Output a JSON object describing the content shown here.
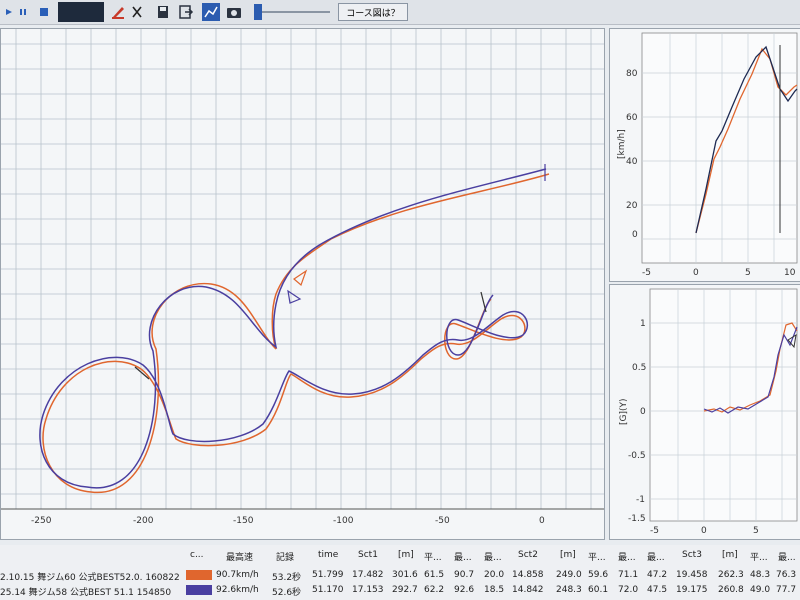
{
  "toolbar": {
    "course_button_label": "コース図は？"
  },
  "colors": {
    "orange": "#e0662e",
    "blue": "#4a3fa0",
    "toolbar_dark": "#1e2a3c"
  },
  "icons": [
    "play-icon",
    "pause-icon",
    "stop-icon",
    "brush-icon",
    "close-icon",
    "save-icon",
    "export-icon",
    "chart-icon",
    "camera-icon"
  ],
  "main_plot": {
    "x_ticks": [
      "-250",
      "-200",
      "-150",
      "-100",
      "-50",
      "0"
    ]
  },
  "speed_plot": {
    "ylabel": "[km/h]",
    "y_ticks": [
      "80",
      "60",
      "40",
      "20",
      "0"
    ],
    "x_ticks": [
      "-5",
      "0",
      "5",
      "10"
    ]
  },
  "g_plot": {
    "ylabel": "[G](Y)",
    "y_ticks": [
      "1",
      "0.5",
      "0",
      "-0.5",
      "-1",
      "-1.5"
    ],
    "x_ticks": [
      "-5",
      "0",
      "5"
    ]
  },
  "table": {
    "headers": [
      "c...",
      "最高速",
      "記録",
      "time",
      "Sct1",
      "[m]",
      "平...",
      "最...",
      "最...",
      "Sct2",
      "[m]",
      "平...",
      "最...",
      "最...",
      "Sct3",
      "[m]",
      "平...",
      "最..."
    ],
    "rows": [
      {
        "label": "2.10.15 舞ジム60 公式BEST52.0. 160822",
        "cells": [
          "90.7km/h",
          "53.2秒",
          "51.799",
          "17.482",
          "301.6",
          "61.5",
          "90.7",
          "20.0",
          "14.858",
          "249.0",
          "59.6",
          "71.1",
          "47.2",
          "19.458",
          "262.3",
          "48.3",
          "76.3"
        ]
      },
      {
        "label": "25.14 舞ジム58 公式BEST 51.1 154850",
        "cells": [
          "92.6km/h",
          "52.6秒",
          "51.170",
          "17.153",
          "292.7",
          "62.2",
          "92.6",
          "18.5",
          "14.842",
          "248.3",
          "60.1",
          "72.0",
          "47.5",
          "19.175",
          "260.8",
          "49.0",
          "77.7"
        ]
      }
    ]
  }
}
